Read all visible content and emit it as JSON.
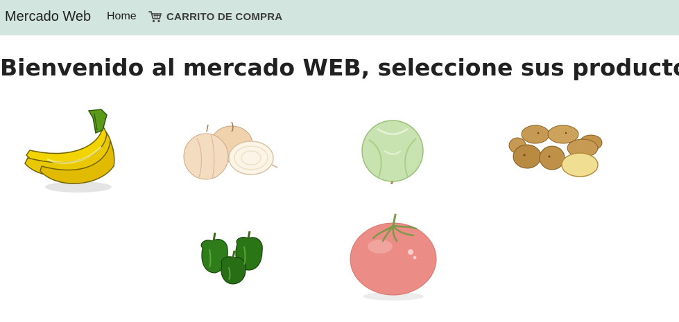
{
  "navbar": {
    "brand": "Mercado Web",
    "home_label": "Home",
    "cart_label": "CARRITO DE COMPRA",
    "background_color": "#d2e5df",
    "cart_icon": "shopping-cart-icon"
  },
  "main": {
    "title": "Bienvenido al mercado WEB, seleccione sus productos"
  },
  "products": [
    {
      "name": "banana",
      "image": "banana-image"
    },
    {
      "name": "onion",
      "image": "onion-image"
    },
    {
      "name": "lettuce",
      "image": "lettuce-image"
    },
    {
      "name": "potato",
      "image": "potato-image"
    },
    {
      "name": "green-pepper",
      "image": "green-pepper-image"
    },
    {
      "name": "tomato",
      "image": "tomato-image"
    }
  ]
}
